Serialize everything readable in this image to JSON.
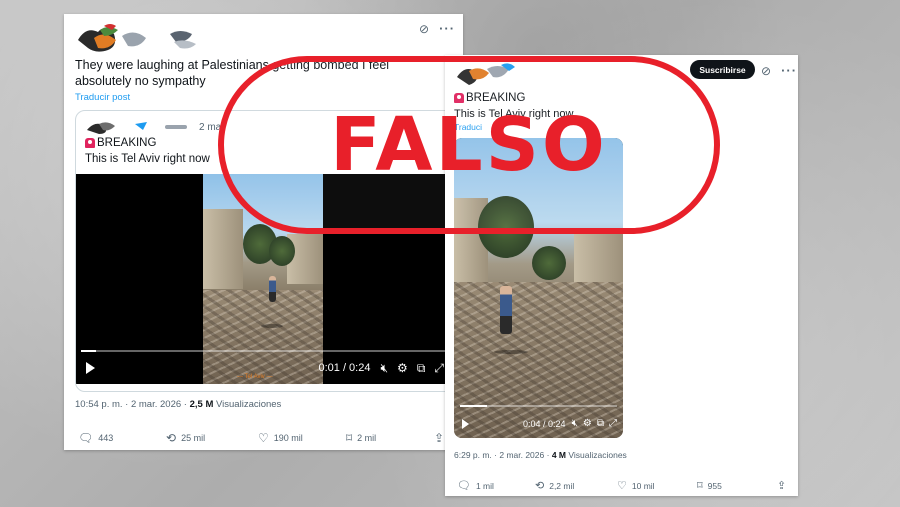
{
  "left_post": {
    "text": "They were laughing at Palestinians getting bombed I feel absolutely no sympathy",
    "translate": "Traducir post",
    "quoted": {
      "date_partial": "2 ma",
      "breaking": "BREAKING",
      "text": "This is Tel Aviv right now"
    },
    "video": {
      "time": "0:01 / 0:24",
      "watermark": "— Tel Aviv —",
      "progress": 0.04
    },
    "meta": {
      "time": "10:54 p. m. · 2 mar. 2026 ·",
      "views_value": "2,5 M",
      "views_label": "Visualizaciones"
    },
    "actions": {
      "replies": "443",
      "reposts": "25 mil",
      "likes": "190 mil",
      "bookmarks": "2 mil"
    }
  },
  "right_post": {
    "subscribe": "Suscribirse",
    "breaking": "BREAKING",
    "text": "This is Tel Aviv right now",
    "translate": "Traduci",
    "video": {
      "time": "0:04 / 0:24",
      "progress": 0.17
    },
    "meta": {
      "time": "6:29 p. m. · 2 mar. 2026 ·",
      "views_value": "4 M",
      "views_label": "Visualizaciones"
    },
    "actions": {
      "replies": "1 mil",
      "reposts": "2,2 mil",
      "likes": "10 mil",
      "bookmarks": "955"
    }
  },
  "stamp": {
    "label": "FALSO",
    "color": "#e8202a"
  },
  "icons": {
    "more": "more-icon",
    "grok": "grok-icon",
    "reply": "reply-icon",
    "repost": "repost-icon",
    "like": "like-icon",
    "bookmark": "bookmark-icon",
    "share": "share-icon"
  },
  "colors": {
    "link": "#1d9bf0",
    "secondary_text": "#536471",
    "breaking_icon": "#e0245e"
  }
}
